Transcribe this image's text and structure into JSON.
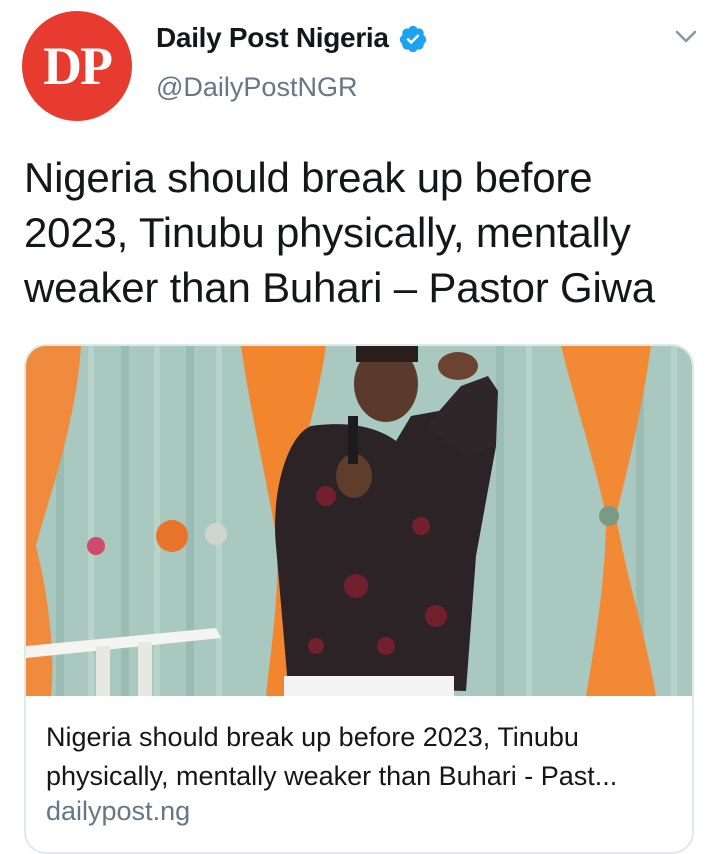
{
  "tweet": {
    "author": {
      "avatar_text": "DP",
      "display_name": "Daily Post Nigeria",
      "handle": "@DailyPostNGR",
      "verified": true,
      "verified_icon": "verified-badge-icon",
      "avatar_color": "#e63b2e"
    },
    "menu_icon": "chevron-down-icon",
    "text_lines": [
      "Nigeria should break up before",
      "2023, Tinubu physically, mentally",
      "weaker than Buhari – Pastor Giwa"
    ],
    "card": {
      "image_icon": "article-photo",
      "title_lines": [
        "Nigeria should break up before 2023, Tinubu",
        "physically, mentally weaker than Buhari - Past..."
      ],
      "domain": "dailypost.ng"
    }
  },
  "colors": {
    "text_primary": "#14171a",
    "text_secondary": "#657786",
    "verified_blue": "#1da1f2",
    "border": "#e1e8ed"
  }
}
